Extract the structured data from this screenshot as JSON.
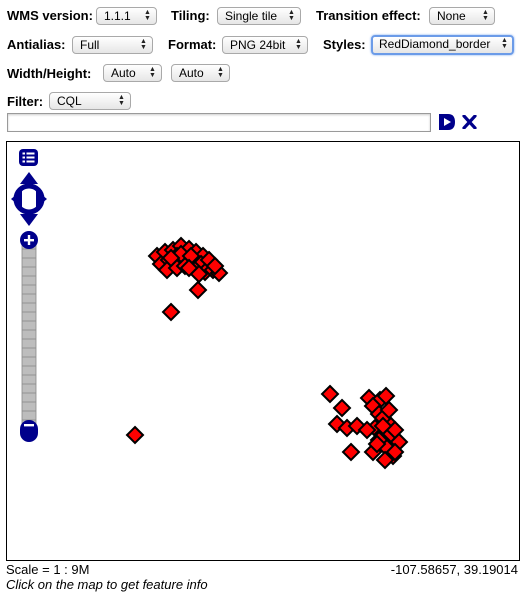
{
  "controls": {
    "wms_version": {
      "label": "WMS version:",
      "value": "1.1.1"
    },
    "tiling": {
      "label": "Tiling:",
      "value": "Single tile"
    },
    "transition": {
      "label": "Transition effect:",
      "value": "None"
    },
    "antialias": {
      "label": "Antialias:",
      "value": "Full"
    },
    "format": {
      "label": "Format:",
      "value": "PNG 24bit"
    },
    "styles": {
      "label": "Styles:",
      "value": "RedDiamond_border"
    },
    "size": {
      "label": "Width/Height:",
      "width": "Auto",
      "height": "Auto"
    },
    "filter": {
      "label": "Filter:",
      "value": "CQL",
      "text": ""
    }
  },
  "map": {
    "feature_color": "#ff0000",
    "feature_border": "#000000",
    "control_color": "#00008b"
  },
  "status": {
    "scale": "Scale = 1 : 9M",
    "coordinates": "-107.58657, 39.19014",
    "hint": "Click on the map to get feature info"
  }
}
